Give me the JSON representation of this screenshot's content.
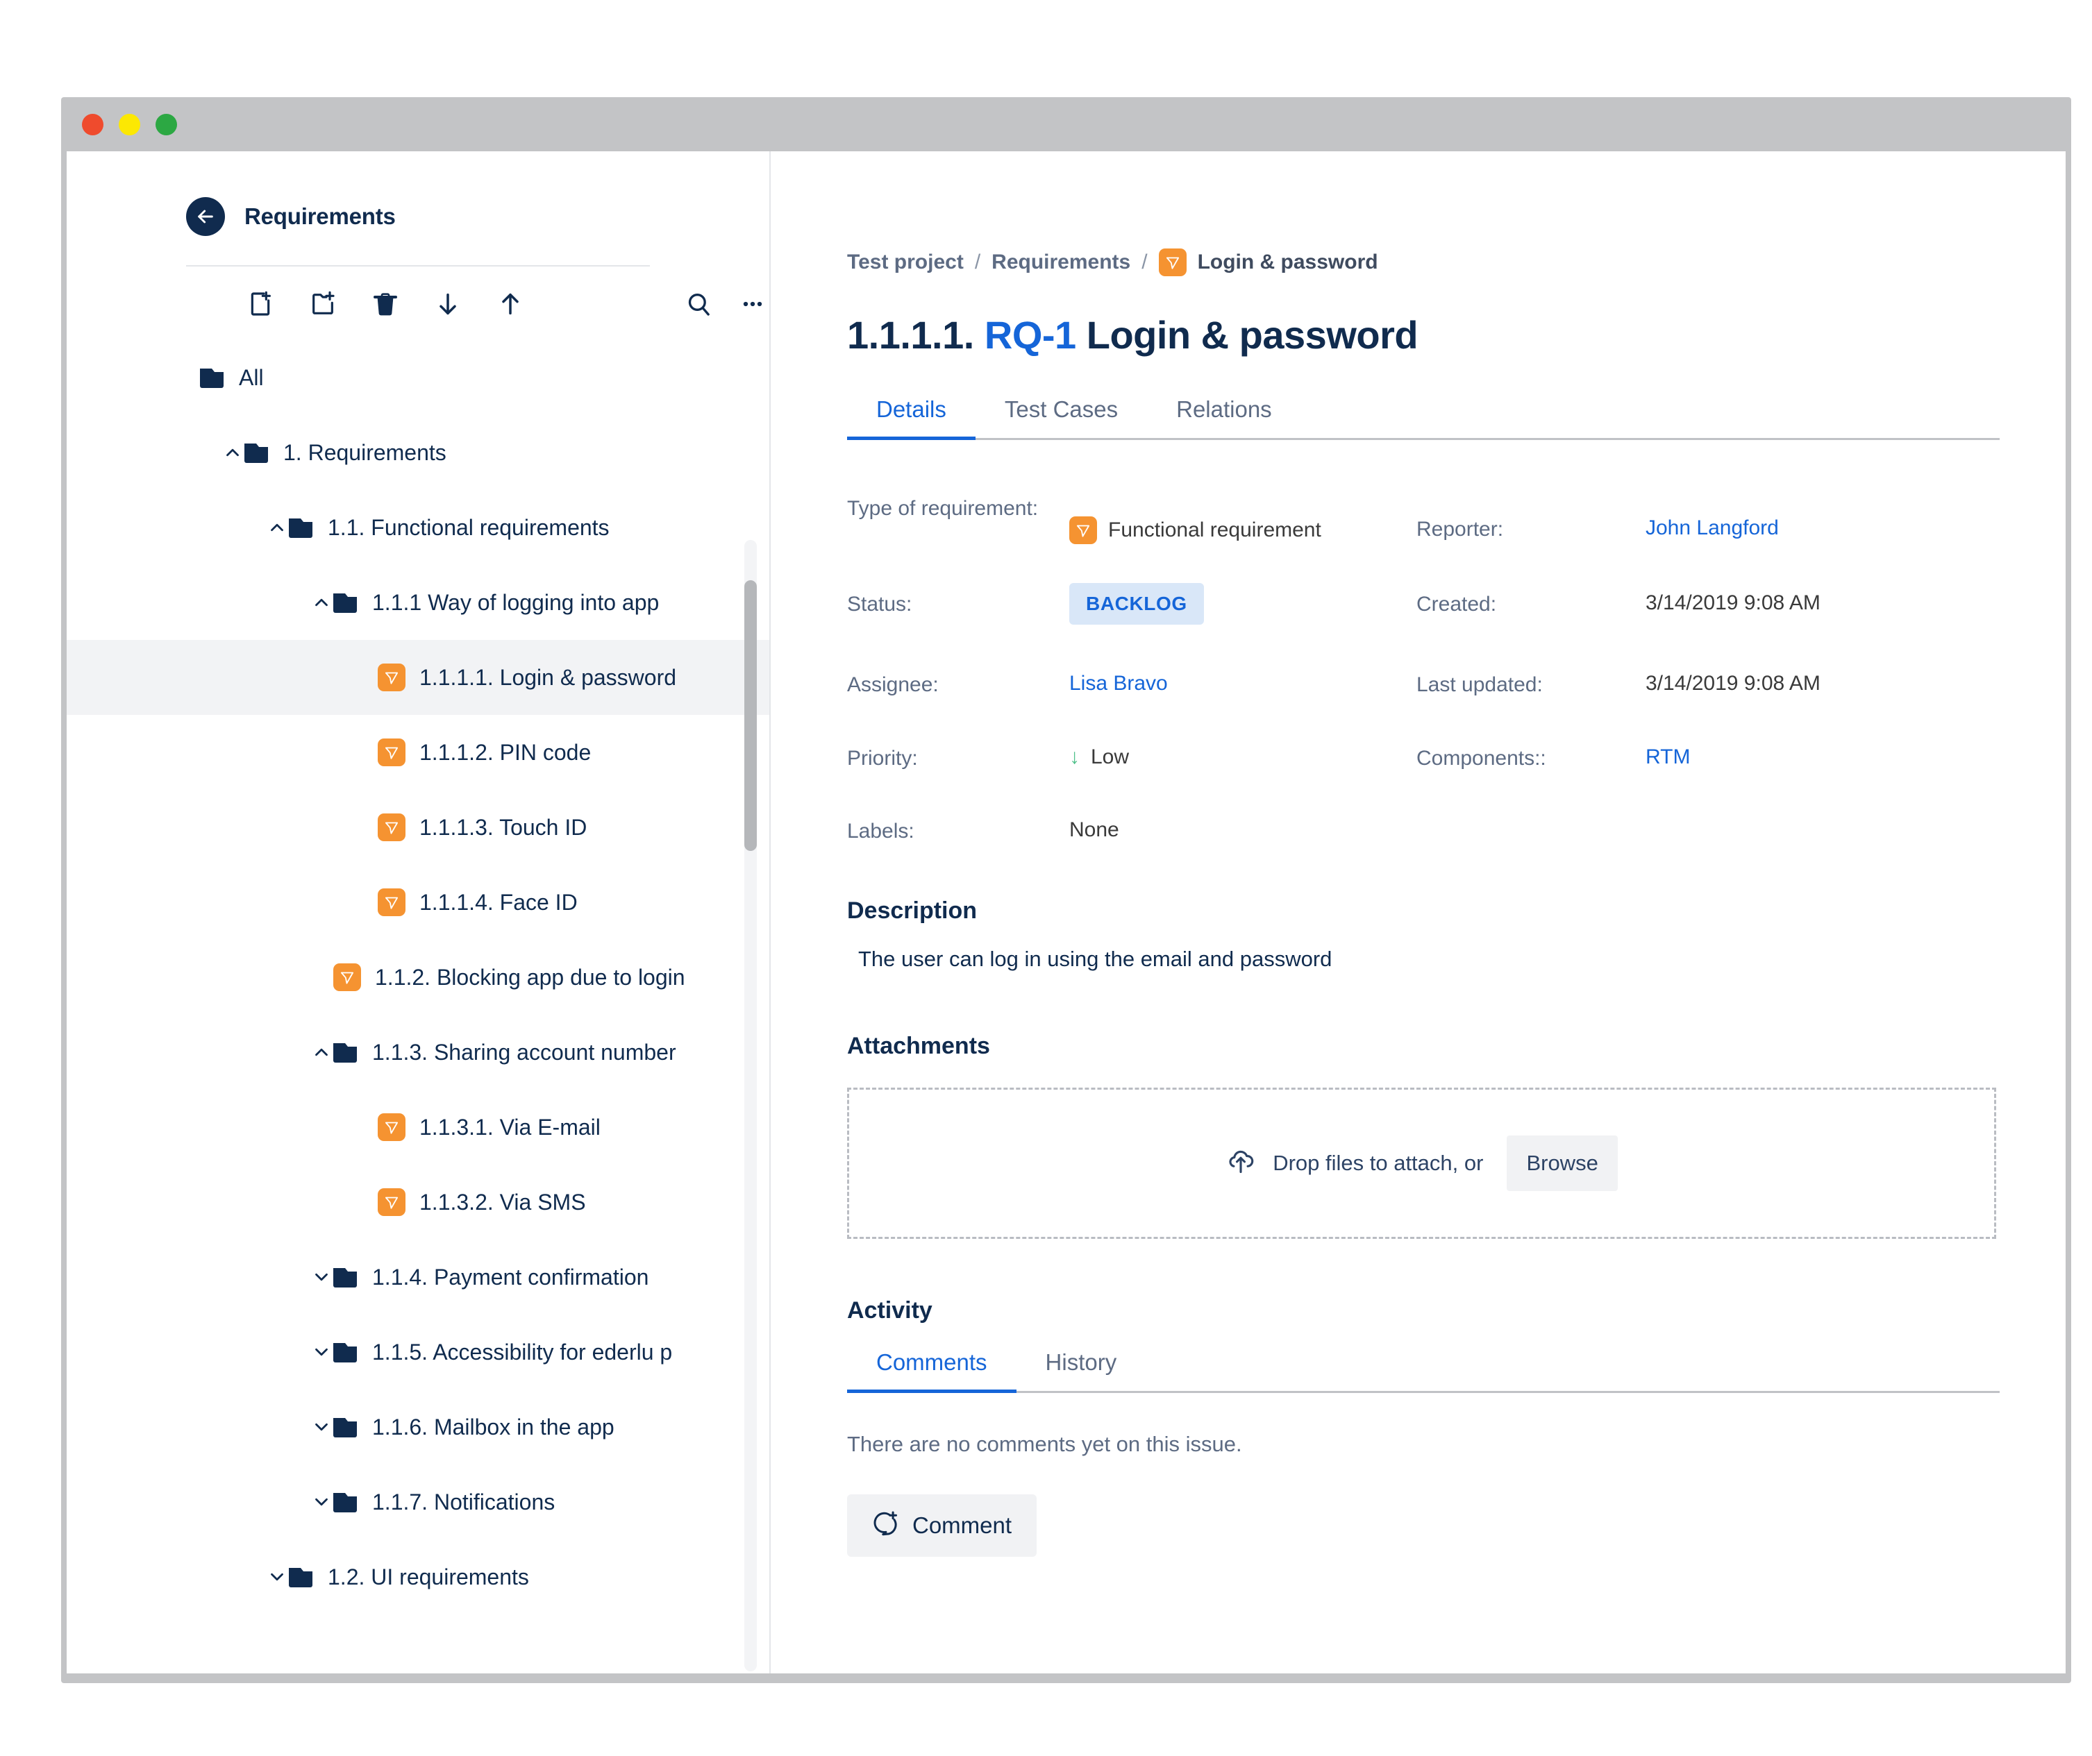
{
  "window": {
    "traffic_lights": [
      "close",
      "minimize",
      "zoom"
    ]
  },
  "sidebar": {
    "title": "Requirements",
    "back_icon": "arrow-left-icon",
    "toolbar": [
      {
        "name": "new-requirement-icon",
        "label": "New requirement"
      },
      {
        "name": "new-folder-icon",
        "label": "New folder"
      },
      {
        "name": "delete-icon",
        "label": "Delete"
      },
      {
        "name": "move-down-icon",
        "label": "Move down"
      },
      {
        "name": "move-up-icon",
        "label": "Move up"
      },
      {
        "name": "search-icon",
        "label": "Search"
      },
      {
        "name": "more-options-icon",
        "label": "More"
      }
    ],
    "tree": [
      {
        "label": "All",
        "indent": 0,
        "type": "folder",
        "chevron": "none",
        "selected": false
      },
      {
        "label": "1. Requirements",
        "indent": 1,
        "type": "folder",
        "chevron": "up",
        "selected": false
      },
      {
        "label": "1.1. Functional requirements",
        "indent": 2,
        "type": "folder",
        "chevron": "up",
        "selected": false
      },
      {
        "label": "1.1.1 Way of logging into app",
        "indent": 3,
        "type": "folder",
        "chevron": "up",
        "selected": false
      },
      {
        "label": "1.1.1.1. Login & password",
        "indent": 4,
        "type": "requirement",
        "chevron": "none",
        "selected": true
      },
      {
        "label": "1.1.1.2. PIN code",
        "indent": 4,
        "type": "requirement",
        "chevron": "none",
        "selected": false
      },
      {
        "label": "1.1.1.3. Touch ID",
        "indent": 4,
        "type": "requirement",
        "chevron": "none",
        "selected": false
      },
      {
        "label": "1.1.1.4. Face ID",
        "indent": 4,
        "type": "requirement",
        "chevron": "none",
        "selected": false
      },
      {
        "label": "1.1.2. Blocking app due to login",
        "indent": 3,
        "type": "requirement",
        "chevron": "none",
        "selected": false
      },
      {
        "label": "1.1.3. Sharing account number",
        "indent": 3,
        "type": "folder",
        "chevron": "up",
        "selected": false
      },
      {
        "label": "1.1.3.1. Via E-mail",
        "indent": 4,
        "type": "requirement",
        "chevron": "none",
        "selected": false
      },
      {
        "label": "1.1.3.2. Via SMS",
        "indent": 4,
        "type": "requirement",
        "chevron": "none",
        "selected": false
      },
      {
        "label": "1.1.4. Payment confirmation",
        "indent": 3,
        "type": "folder",
        "chevron": "down",
        "selected": false
      },
      {
        "label": "1.1.5. Accessibility for ederlu p",
        "indent": 3,
        "type": "folder",
        "chevron": "down",
        "selected": false
      },
      {
        "label": "1.1.6. Mailbox in the app",
        "indent": 3,
        "type": "folder",
        "chevron": "down",
        "selected": false
      },
      {
        "label": "1.1.7. Notifications",
        "indent": 3,
        "type": "folder",
        "chevron": "down",
        "selected": false
      },
      {
        "label": "1.2. UI requirements",
        "indent": 2,
        "type": "folder",
        "chevron": "down",
        "selected": false
      }
    ]
  },
  "main": {
    "breadcrumb": {
      "project": "Test project",
      "section": "Requirements",
      "current": "Login & password",
      "separator": "/",
      "current_icon": "requirement-icon"
    },
    "title": {
      "number": "1.1.1.1.",
      "key": "RQ-1",
      "name": "Login & password"
    },
    "tabs": [
      {
        "label": "Details",
        "active": true
      },
      {
        "label": "Test Cases",
        "active": false
      },
      {
        "label": "Relations",
        "active": false
      }
    ],
    "fields": {
      "type_label": "Type of requirement:",
      "type_value": "Functional requirement",
      "status_label": "Status:",
      "status_value": "BACKLOG",
      "assignee_label": "Assignee:",
      "assignee_value": "Lisa Bravo",
      "priority_label": "Priority:",
      "priority_value": "Low",
      "priority_icon": "arrow-down-icon",
      "labels_label": "Labels:",
      "labels_value": "None",
      "reporter_label": "Reporter:",
      "reporter_value": "John Langford",
      "created_label": "Created:",
      "created_value": "3/14/2019 9:08 AM",
      "updated_label": "Last updated:",
      "updated_value": "3/14/2019 9:08 AM",
      "components_label": "Components::",
      "components_value": "RTM"
    },
    "description": {
      "heading": "Description",
      "text": "The user can log in using the email and password"
    },
    "attachments": {
      "heading": "Attachments",
      "drop_text": "Drop files to attach, or",
      "browse_label": "Browse",
      "upload_icon": "cloud-upload-icon"
    },
    "activity": {
      "heading": "Activity",
      "tabs": [
        {
          "label": "Comments",
          "active": true
        },
        {
          "label": "History",
          "active": false
        }
      ],
      "empty_text": "There are no comments yet on this issue.",
      "comment_button": "Comment",
      "comment_icon": "add-comment-icon"
    }
  },
  "colors": {
    "accent_blue": "#1565d8",
    "navy": "#102b4e",
    "orange": "#f59331",
    "muted": "#5d6b83",
    "badge_bg": "#d9e7f8",
    "priority_green": "#4fc08a"
  }
}
